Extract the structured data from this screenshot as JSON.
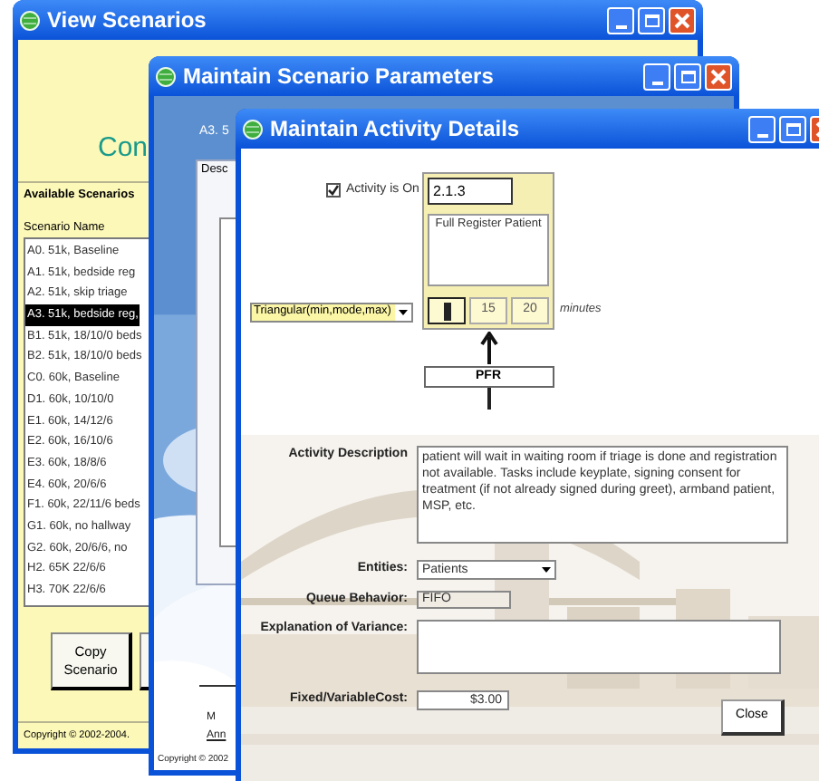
{
  "scenarios_window": {
    "title": "View Scenarios",
    "heading": "Con",
    "list_title": "Available Scenarios",
    "column_header": "Scenario Name",
    "scenarios": [
      {
        "name": "A0. 51k, Baseline",
        "selected": false
      },
      {
        "name": "A1. 51k, bedside reg",
        "selected": false
      },
      {
        "name": "A2. 51k, skip triage",
        "selected": false
      },
      {
        "name": "A3. 51k, bedside reg,",
        "selected": true
      },
      {
        "name": "B1. 51k, 18/10/0 beds",
        "selected": false
      },
      {
        "name": "B2. 51k, 18/10/0 beds",
        "selected": false
      },
      {
        "name": "C0. 60k, Baseline",
        "selected": false
      },
      {
        "name": "D1. 60k, 10/10/0",
        "selected": false
      },
      {
        "name": "E1. 60k, 14/12/6",
        "selected": false
      },
      {
        "name": "E2. 60k, 16/10/6",
        "selected": false
      },
      {
        "name": "E3. 60k, 18/8/6",
        "selected": false
      },
      {
        "name": "E4. 60k, 20/6/6",
        "selected": false
      },
      {
        "name": "F1. 60k, 22/11/6 beds",
        "selected": false
      },
      {
        "name": "G1. 60k, no hallway",
        "selected": false
      },
      {
        "name": "G2. 60k, 20/6/6, no",
        "selected": false
      },
      {
        "name": "H2. 65K 22/6/6",
        "selected": false
      },
      {
        "name": "H3. 70K 22/6/6",
        "selected": false
      }
    ],
    "buttons": [
      "Copy Scenario"
    ],
    "copyright": "Copyright © 2002-2004."
  },
  "parameters_window": {
    "title": "Maintain Scenario Parameters",
    "scenario": "A3. 5",
    "tab": "Desc",
    "footer_lines": [
      "M",
      "Ann"
    ],
    "copyright": "Copyright © 2002"
  },
  "activity_window": {
    "title": "Maintain Activity Details",
    "active": {
      "label": "Activity is On",
      "checked": true
    },
    "code": "2.1.3",
    "name": "Full Register Patient",
    "distribution": "Triangular(min,mode,max)",
    "durations": [
      {
        "focused": true
      },
      {
        "value": "15",
        "focused": false
      },
      {
        "value": "20",
        "focused": false
      }
    ],
    "unit": "minutes",
    "resource": "PFR",
    "fields": [
      {
        "kind": "textarea",
        "label": "Activity Description",
        "value": "patient will wait in waiting room if triage is done and registration not available.  Tasks include keyplate, signing consent for treatment (if not already signed during greet), armband patient, MSP, etc."
      },
      {
        "kind": "dropdown",
        "label": "Entities:",
        "value": "Patients"
      },
      {
        "kind": "text",
        "label": "Queue Behavior:",
        "value": "FIFO"
      },
      {
        "kind": "textarea_small",
        "label": "Explanation of Variance:"
      },
      {
        "kind": "money",
        "label": "Fixed/VariableCost:",
        "value": "$3.00"
      }
    ],
    "button": "Close"
  }
}
